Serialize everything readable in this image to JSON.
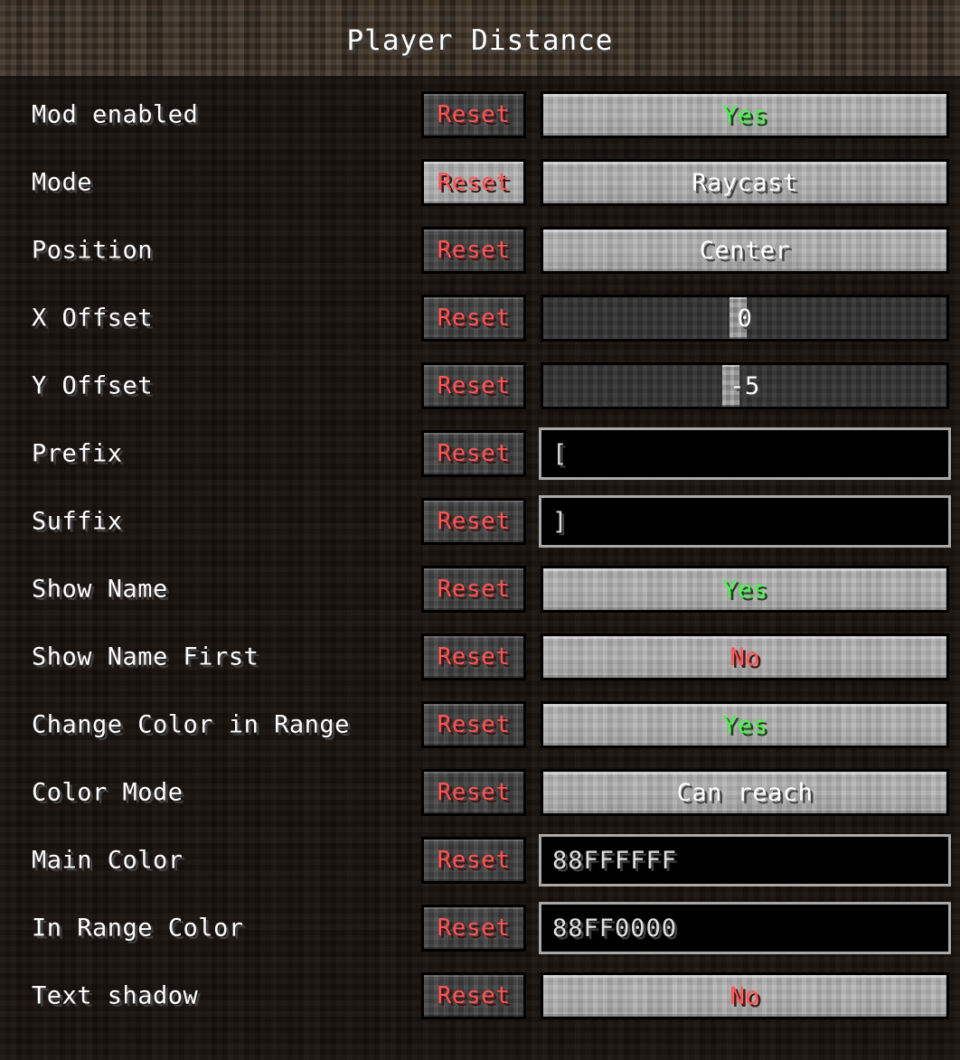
{
  "header": {
    "title": "Player Distance"
  },
  "reset_label": "Reset",
  "rows": [
    {
      "label": "Mod enabled",
      "control": "button",
      "value": "Yes",
      "value_kind": "yes",
      "reset_hover": false
    },
    {
      "label": "Mode",
      "control": "button",
      "value": "Raycast",
      "value_kind": "neutral",
      "reset_hover": true
    },
    {
      "label": "Position",
      "control": "button",
      "value": "Center",
      "value_kind": "neutral",
      "reset_hover": false
    },
    {
      "label": "X Offset",
      "control": "slider",
      "value": "0",
      "handle_pct": 48.2,
      "reset_hover": false
    },
    {
      "label": "Y Offset",
      "control": "slider",
      "value": "-5",
      "handle_pct": 46.5,
      "reset_hover": false
    },
    {
      "label": "Prefix",
      "control": "text",
      "value": "[",
      "reset_hover": false
    },
    {
      "label": "Suffix",
      "control": "text",
      "value": "]",
      "reset_hover": false
    },
    {
      "label": "Show Name",
      "control": "button",
      "value": "Yes",
      "value_kind": "yes",
      "reset_hover": false
    },
    {
      "label": "Show Name First",
      "control": "button",
      "value": "No",
      "value_kind": "no",
      "reset_hover": false
    },
    {
      "label": "Change Color in Range",
      "control": "button",
      "value": "Yes",
      "value_kind": "yes",
      "reset_hover": false
    },
    {
      "label": "Color Mode",
      "control": "button",
      "value": "Can reach",
      "value_kind": "neutral",
      "reset_hover": false
    },
    {
      "label": "Main Color",
      "control": "text",
      "value": "88FFFFFF",
      "reset_hover": false
    },
    {
      "label": "In Range Color",
      "control": "text",
      "value": "88FF0000",
      "reset_hover": false
    },
    {
      "label": "Text shadow",
      "control": "button",
      "value": "No",
      "value_kind": "no",
      "reset_hover": false
    }
  ],
  "colors": {
    "accent_reset": "#FC5454",
    "value_yes": "#4EF04E",
    "value_no": "#FC5454",
    "text": "#FFFFFF",
    "header_bg": "#352A20",
    "body_bg": "#15100C",
    "button_face": "#A9A9A9",
    "reset_face": "#3B3B3B"
  }
}
